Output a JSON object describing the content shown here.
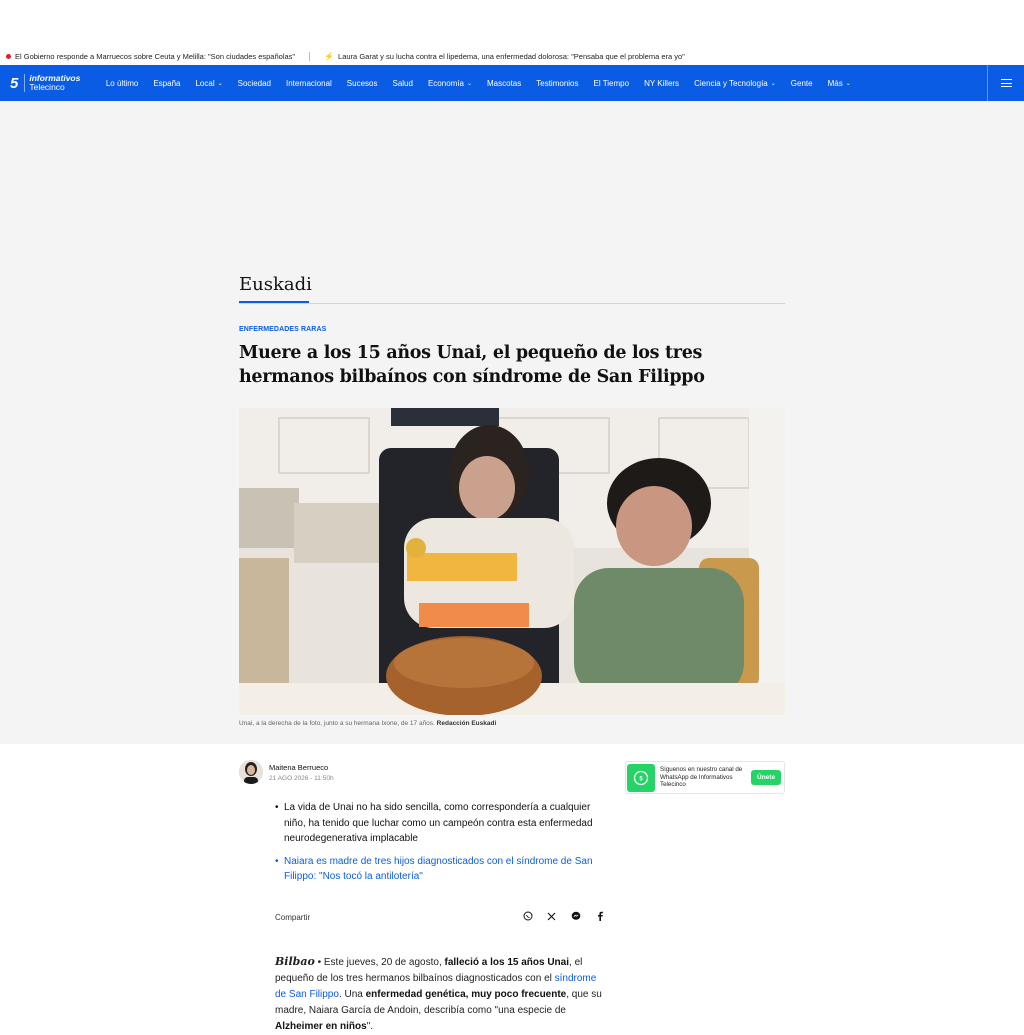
{
  "ticker": [
    {
      "text": "El Gobierno responde a Marruecos sobre Ceuta y Melilla: \"Son ciudades españolas\""
    },
    {
      "text": "Laura Garat y su lucha contra el lipedema, una enfermedad dolorosa: \"Pensaba que el problema era yo\""
    }
  ],
  "logo": {
    "number": "5",
    "line1": "informativos",
    "line2": "Telecinco"
  },
  "nav": [
    {
      "label": "Lo último",
      "dropdown": false
    },
    {
      "label": "España",
      "dropdown": false
    },
    {
      "label": "Local",
      "dropdown": true
    },
    {
      "label": "Sociedad",
      "dropdown": false
    },
    {
      "label": "Internacional",
      "dropdown": false
    },
    {
      "label": "Sucesos",
      "dropdown": false
    },
    {
      "label": "Salud",
      "dropdown": false
    },
    {
      "label": "Economía",
      "dropdown": true
    },
    {
      "label": "Mascotas",
      "dropdown": false
    },
    {
      "label": "Testimonios",
      "dropdown": false
    },
    {
      "label": "El Tiempo",
      "dropdown": false
    },
    {
      "label": "NY Killers",
      "dropdown": false
    },
    {
      "label": "Ciencia y Tecnología",
      "dropdown": true
    },
    {
      "label": "Gente",
      "dropdown": false
    },
    {
      "label": "Más",
      "dropdown": true
    }
  ],
  "section": {
    "title": "Euskadi"
  },
  "article": {
    "kicker": "ENFERMEDADES RARAS",
    "headline": "Muere a los 15 años Unai, el pequeño de los tres hermanos bilbaínos con síndrome de San Filippo",
    "caption": "Unai, a la derecha de la foto, junto a su hermana Ixone, de 17 años.",
    "caption_credit": "Redacción Euskadi",
    "author": "Maitena Berrueco",
    "date": "21 AGO 2026 - 11:50h",
    "bullets": [
      {
        "text": "La vida de Unai no ha sido sencilla, como correspondería a cualquier niño, ha tenido que luchar como un campeón contra esta enfermedad neurodegenerativa implacable",
        "link": false
      },
      {
        "text": "Naiara es madre de tres hijos diagnosticados con el síndrome de San Filippo: \"Nos tocó la antilotería\"",
        "link": true
      }
    ],
    "share_label": "Compartir",
    "share_icons": [
      "whatsapp-icon",
      "x-icon",
      "messenger-icon",
      "facebook-icon"
    ],
    "body": {
      "place": "Bilbao",
      "p1": "Este jueves, 20 de agosto, ",
      "b1": "falleció a los 15 años Unai",
      "p2": ", el pequeño de los tres hermanos bilbaínos diagnosticados con el ",
      "l1": "síndrome de San Filippo",
      "p3": ". Una ",
      "b2": "enfermedad genética, muy poco frecuente",
      "p4": ", que su madre, Naiara García de Andoin, describía como \"una especie de ",
      "b3": "Alzheimer en niños",
      "p5": "\"."
    }
  },
  "whatsapp": {
    "text": "Síguenos en nuestro canal de WhatsApp de Informativos Telecinco",
    "button": "Únete"
  },
  "colors": {
    "brand": "#0b5ce5",
    "whatsapp": "#25d366",
    "ticker_dot": "#e0202a"
  }
}
